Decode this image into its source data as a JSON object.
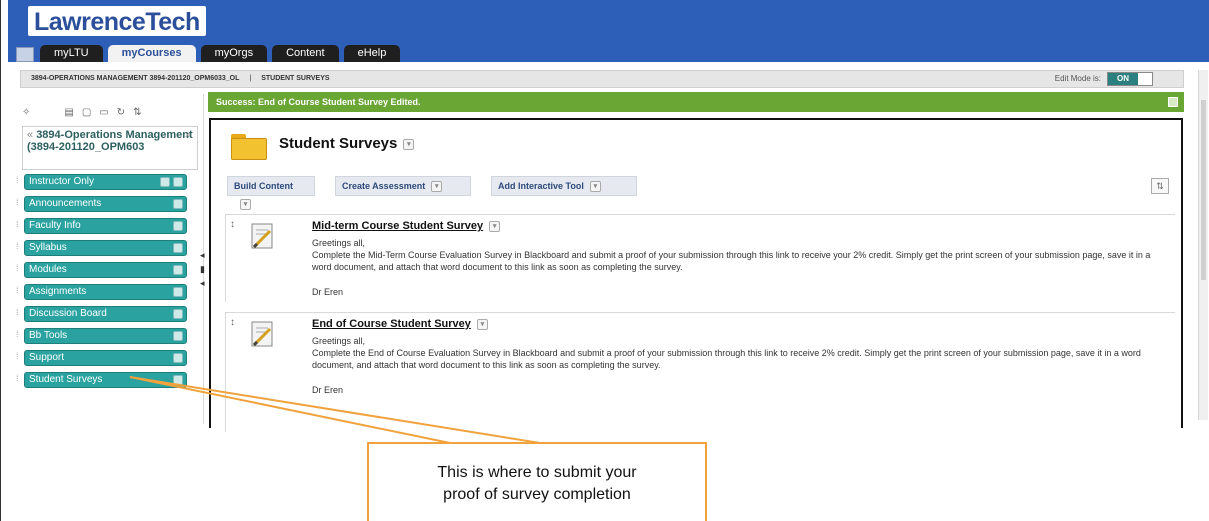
{
  "header": {
    "logo_text": "LawrenceTech",
    "tabs": [
      "myLTU",
      "myCourses",
      "myOrgs",
      "Content",
      "eHelp"
    ]
  },
  "breadcrumb": {
    "course": "3894-OPERATIONS MANAGEMENT 3894-201120_OPM6033_OL",
    "page": "STUDENT SURVEYS",
    "edit_mode_label": "Edit Mode is:",
    "edit_mode_value": "ON"
  },
  "sidebar": {
    "course_title": "3894-Operations Management (3894-201120_OPM603",
    "items": [
      {
        "label": "Instructor Only"
      },
      {
        "label": "Announcements"
      },
      {
        "label": "Faculty Info"
      },
      {
        "label": "Syllabus"
      },
      {
        "label": "Modules"
      },
      {
        "label": "Assignments"
      },
      {
        "label": "Discussion Board"
      },
      {
        "label": "Bb Tools"
      },
      {
        "label": "Support"
      },
      {
        "label": "Student Surveys"
      }
    ]
  },
  "main": {
    "success_message": "Success: End of Course Student Survey Edited.",
    "page_title": "Student Surveys",
    "actions": [
      "Build Content",
      "Create Assessment",
      "Add Interactive Tool"
    ],
    "items": [
      {
        "title": "Mid-term Course Student Survey",
        "greeting": "Greetings all,",
        "body": "Complete the Mid-Term Course Evaluation Survey in Blackboard and submit a proof of your submission through this link to receive your 2% credit. Simply get the print screen of your submission page, save it in a word document, and attach that word document to this link as soon as completing the survey.",
        "signature": "Dr Eren"
      },
      {
        "title": "End of Course Student Survey",
        "greeting": "Greetings all,",
        "body": "Complete the End of Course Evaluation Survey in Blackboard and submit a proof of your submission through this link to receive 2% credit. Simply get the print screen of your submission page, save it in a word document, and attach that word document to this link as soon as completing the survey.",
        "signature": "Dr Eren"
      }
    ]
  },
  "callout": {
    "line1": "This is where to submit your",
    "line2": "proof of survey completion"
  },
  "colors": {
    "header_blue": "#2d5fb8",
    "nav_teal": "#2aa3a0",
    "success_green": "#6aa633",
    "callout_orange": "#f0a23c"
  }
}
